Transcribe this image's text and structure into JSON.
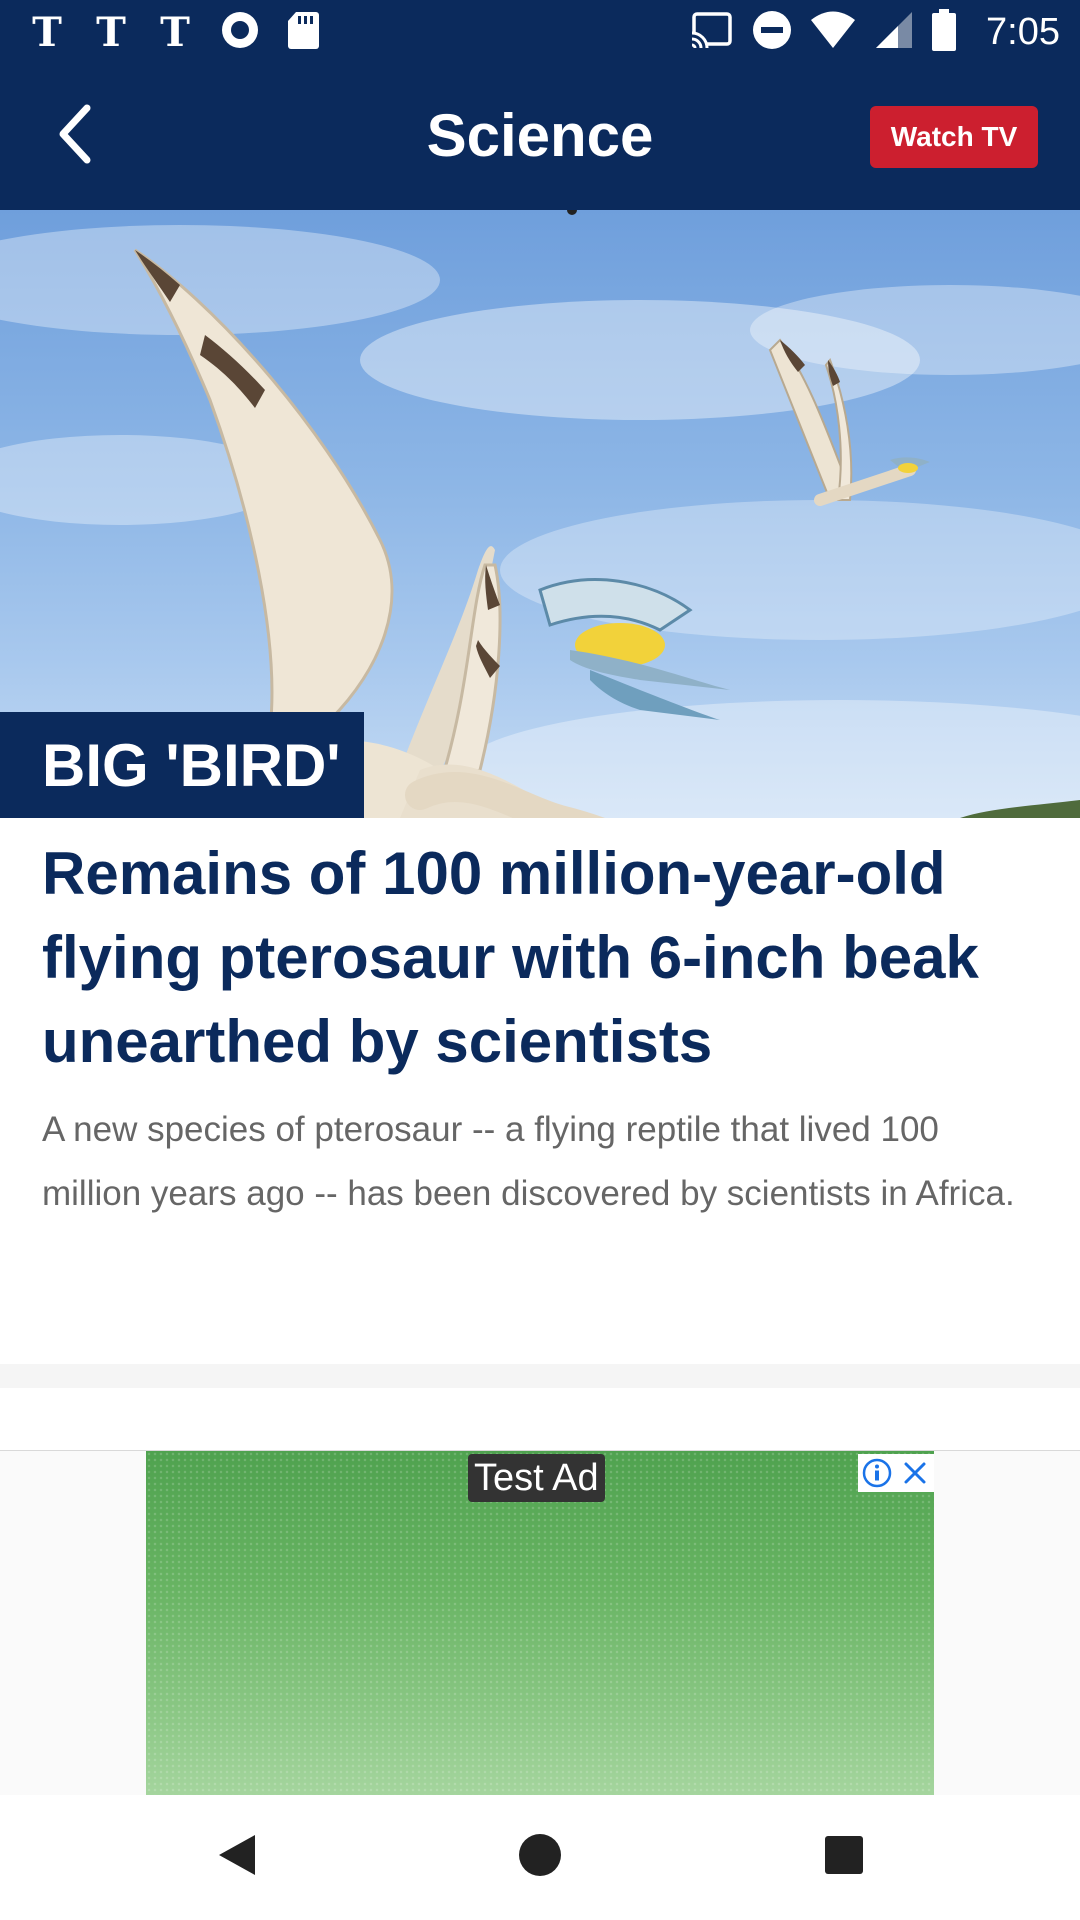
{
  "status_bar": {
    "time": "7:05",
    "icons_left": [
      "nyt-logo-icon",
      "nyt-logo-icon",
      "nyt-logo-icon",
      "record-icon",
      "sd-card-icon"
    ],
    "nyt_glyph": "𝕿",
    "icons_right": [
      "cast-icon",
      "do-not-disturb-icon",
      "wifi-icon",
      "cell-signal-icon",
      "battery-icon"
    ]
  },
  "app_bar": {
    "back_icon": "chevron-left-icon",
    "title": "Science",
    "watch_tv_label": "Watch TV",
    "bar_color": "#0b2a5c",
    "accent_color": "#cc1f2f"
  },
  "hero": {
    "label": "BIG 'BIRD'"
  },
  "article": {
    "title": "Remains of 100 million-year-old flying pterosaur with 6-inch beak unearthed by scientists",
    "summary": "A new species of pterosaur -- a flying reptile that lived 100 million years ago -- has been discovered by scientists in Africa."
  },
  "ad": {
    "label": "Test Ad",
    "info_icon": "info-icon",
    "close_icon": "close-icon"
  },
  "nav_bar": {
    "back_icon": "triangle-back-icon",
    "home_icon": "circle-home-icon",
    "recents_icon": "square-recents-icon"
  }
}
